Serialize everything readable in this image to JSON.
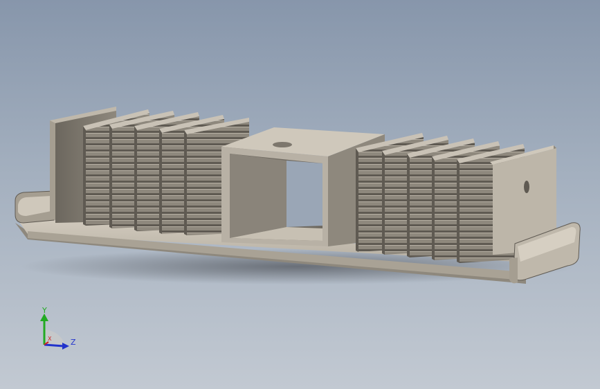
{
  "triad": {
    "y_label": "Y",
    "z_label": "Z",
    "x_label": "X"
  },
  "colors": {
    "background_top": "#8796ab",
    "background_bottom": "#c2c9d2",
    "metal_face": "#c9c2b6",
    "metal_side": "#8e887d",
    "metal_dark": "#5f5a52",
    "metal_shadow": "#3c3a37",
    "axis_y": "#22aa22",
    "axis_z": "#2233cc",
    "axis_x": "#cc2222"
  },
  "model": {
    "part": "heat-sink-extrusion",
    "fin_count_left": 5,
    "fin_count_right": 5
  }
}
